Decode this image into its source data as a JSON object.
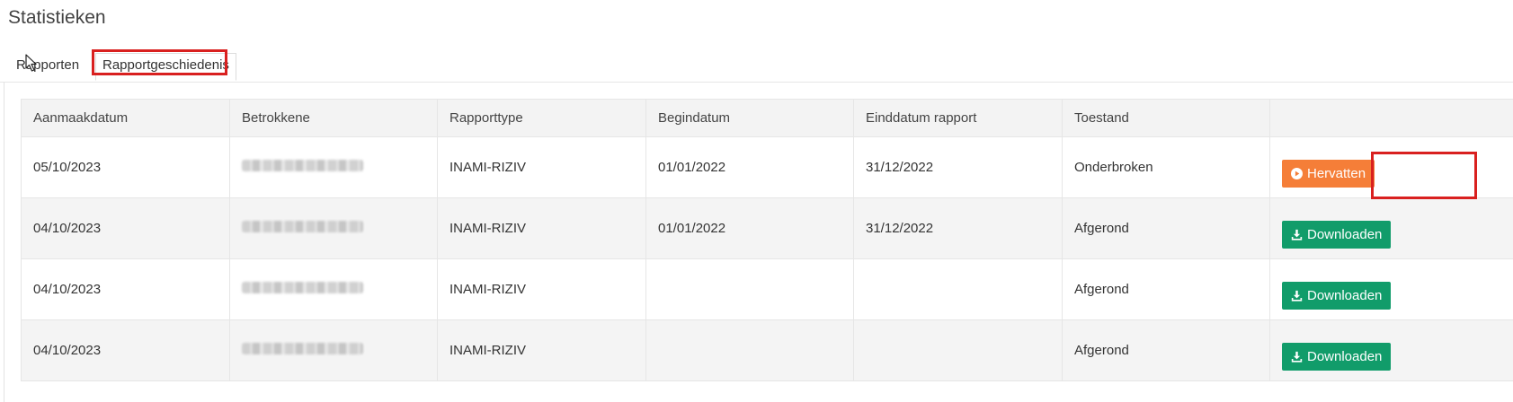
{
  "page": {
    "title": "Statistieken"
  },
  "tabs": [
    {
      "label": "Rapporten"
    },
    {
      "label": "Rapportgeschiedenis"
    }
  ],
  "table": {
    "headers": [
      "Aanmaakdatum",
      "Betrokkene",
      "Rapporttype",
      "Begindatum",
      "Einddatum rapport",
      "Toestand",
      ""
    ],
    "rows": [
      {
        "created": "05/10/2023",
        "report_type": "INAMI-RIZIV",
        "start": "01/01/2022",
        "end": "31/12/2022",
        "status": "Onderbroken",
        "action": "Hervatten",
        "action_icon": "play-circle-icon"
      },
      {
        "created": "04/10/2023",
        "report_type": "INAMI-RIZIV",
        "start": "01/01/2022",
        "end": "31/12/2022",
        "status": "Afgerond",
        "action": "Downloaden",
        "action_icon": "download-icon"
      },
      {
        "created": "04/10/2023",
        "report_type": "INAMI-RIZIV",
        "start": "",
        "end": "",
        "status": "Afgerond",
        "action": "Downloaden",
        "action_icon": "download-icon"
      },
      {
        "created": "04/10/2023",
        "report_type": "INAMI-RIZIV",
        "start": "",
        "end": "",
        "status": "Afgerond",
        "action": "Downloaden",
        "action_icon": "download-icon"
      }
    ]
  },
  "colors": {
    "resume": "#f57e38",
    "download": "#119c6a",
    "highlight": "#d9201f"
  }
}
